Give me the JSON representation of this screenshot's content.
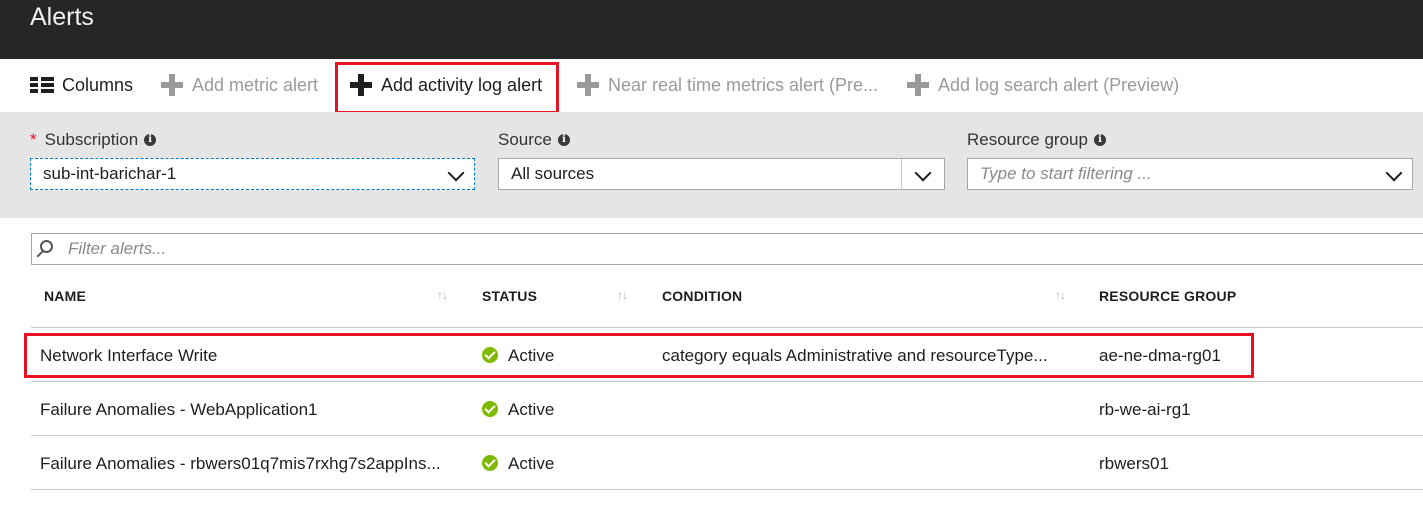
{
  "header": {
    "title": "Alerts"
  },
  "toolbar": {
    "columns": "Columns",
    "add_metric_alert": "Add metric alert",
    "add_activity_log_alert": "Add activity log alert",
    "near_real_time": "Near real time metrics alert (Pre...",
    "add_log_search": "Add log search alert (Preview)"
  },
  "filters": {
    "subscription_label": "Subscription",
    "subscription_required": "*",
    "subscription_value": "sub-int-barichar-1",
    "source_label": "Source",
    "source_value": "All sources",
    "resource_group_label": "Resource group",
    "resource_group_placeholder": "Type to start filtering ..."
  },
  "search": {
    "placeholder": "Filter alerts..."
  },
  "table": {
    "columns": [
      "NAME",
      "STATUS",
      "CONDITION",
      "RESOURCE GROUP"
    ],
    "rows": [
      {
        "name": "Network Interface Write",
        "status": "Active",
        "condition": "category equals Administrative and resourceType...",
        "resource_group": "ae-ne-dma-rg01"
      },
      {
        "name": "Failure Anomalies - WebApplication1",
        "status": "Active",
        "condition": "",
        "resource_group": "rb-we-ai-rg1"
      },
      {
        "name": "Failure Anomalies - rbwers01q7mis7rxhg7s2appIns...",
        "status": "Active",
        "condition": "",
        "resource_group": "rbwers01"
      }
    ]
  },
  "colors": {
    "header_bg": "#262626",
    "highlight": "#e81123",
    "active_status": "#7fba00",
    "filter_band": "#e5e5e5"
  }
}
